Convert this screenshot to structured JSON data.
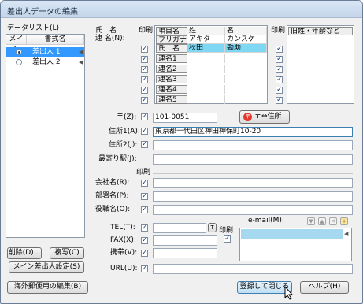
{
  "window": {
    "title": "差出人データの編集"
  },
  "datalist": {
    "group_label": "データリスト(L)",
    "columns": [
      "メイン",
      "書式名"
    ],
    "rows": [
      {
        "name": "差出人 1",
        "main": true,
        "selected": true
      },
      {
        "name": "差出人 2",
        "main": false,
        "selected": false
      }
    ],
    "buttons": {
      "delete": "削除(D)...",
      "copy": "複写(C)",
      "set_main": "メイン差出人設定(S)"
    }
  },
  "name_section": {
    "label_shimei": "氏　名",
    "label_renmei": "連 名(N):",
    "print_label": "印刷",
    "grid_headers": [
      "項目名",
      "姓",
      "名"
    ],
    "rows": [
      {
        "item": "フリガナ",
        "sei": "アキタ",
        "mei": "カンスケ"
      },
      {
        "item": "氏　名",
        "sei": "秋田",
        "mei": "勘助"
      },
      {
        "item": "連名1",
        "sei": "",
        "mei": ""
      },
      {
        "item": "連名2",
        "sei": "",
        "mei": ""
      },
      {
        "item": "連名3",
        "sei": "",
        "mei": ""
      },
      {
        "item": "連名4",
        "sei": "",
        "mei": ""
      },
      {
        "item": "連名5",
        "sei": "",
        "mei": ""
      }
    ],
    "print_label_right": "印刷",
    "old_name_header": "旧姓・年齢など"
  },
  "address": {
    "zip_label": "〒(Z):",
    "zip_value": "101-0051",
    "zip_button": "〒⇔住所",
    "addr1_label": "住所1(A):",
    "addr1_value": "東京都千代田区神田神保町10-20",
    "addr2_label": "住所2(J):",
    "addr2_value": "",
    "station_label": "最寄り駅(J):",
    "station_value": ""
  },
  "company": {
    "print_label": "印刷",
    "company_label": "会社名(R):",
    "dept_label": "部署名(P):",
    "title_label": "役職名(O):"
  },
  "contact": {
    "tel_label": "TEL(T):",
    "fax_label": "FAX(X):",
    "mobile_label": "携帯(V):",
    "url_label": "URL(U):",
    "print_label": "印刷",
    "email_label": "e-mail(M):"
  },
  "footer": {
    "overseas_button": "海外郵便用の編集(B)",
    "register_button": "登録して閉じる",
    "help_button": "ヘルプ(H)"
  },
  "colors": {
    "selection": "#3399ff",
    "grid_selection": "#7ed8f4",
    "title_bar": "#c4d5ea"
  }
}
